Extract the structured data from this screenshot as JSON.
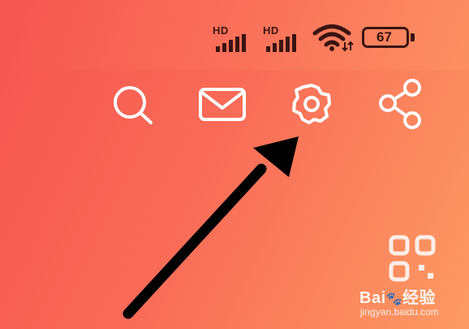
{
  "status_bar": {
    "sim1_label": "HD",
    "sim2_label": "HD",
    "wifi_icon": "wifi-icon",
    "battery_level": "67"
  },
  "toolbar": {
    "icons": [
      "search-icon",
      "mail-icon",
      "settings-gear-icon",
      "share-icon"
    ]
  },
  "annotation": {
    "arrow_target": "settings"
  },
  "watermark": {
    "logo_text": "Bai",
    "logo_suffix": "经验",
    "url": "jingyan.baidu.com"
  },
  "colors": {
    "background_start": "#f65550",
    "background_end": "#fc9a63",
    "icon_stroke": "#ffffff",
    "status_ink": "#3a1410",
    "arrow": "#000000"
  }
}
